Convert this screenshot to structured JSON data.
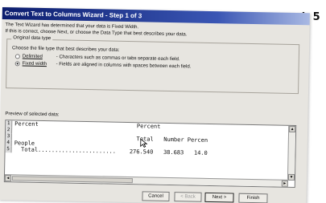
{
  "slide_label": "sl. 5",
  "window": {
    "title": "Convert Text to Columns Wizard - Step 1 of 3"
  },
  "intro": {
    "line1": "The Text Wizard has determined that your data is Fixed Width.",
    "line2": "If this is correct, choose Next, or choose the Data Type that best describes your data."
  },
  "original_data_type": {
    "legend": "Original data type",
    "prompt": "Choose the file type that best describes your data:",
    "options": [
      {
        "label": "Delimited",
        "description": "- Characters such as commas or tabs separate each field.",
        "checked": false
      },
      {
        "label": "Fixed width",
        "description": "- Fields are aligned in columns with spaces between each field.",
        "checked": true
      }
    ]
  },
  "preview": {
    "label": "Preview of selected data:",
    "rows": [
      {
        "num": "1",
        "text": "Percent                             Percent"
      },
      {
        "num": "2",
        "text": ""
      },
      {
        "num": "3",
        "text": "                                    Total   Number Percen"
      },
      {
        "num": "4",
        "text": "People"
      },
      {
        "num": "5",
        "text": "  Total.......................    276.540   38.683   14.0"
      }
    ]
  },
  "buttons": {
    "cancel": "Cancel",
    "back": "< Back",
    "next": "Next >",
    "finish": "Finish"
  }
}
